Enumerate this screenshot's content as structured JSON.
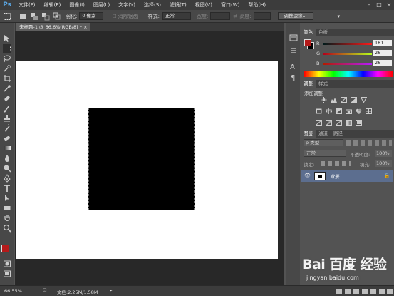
{
  "app": {
    "logo": "Ps"
  },
  "menubar": {
    "items": [
      "文件(F)",
      "编辑(E)",
      "图像(I)",
      "图层(L)",
      "文字(Y)",
      "选择(S)",
      "滤镜(T)",
      "视图(V)",
      "窗口(W)",
      "帮助(H)"
    ]
  },
  "options_bar": {
    "feather_label": "羽化:",
    "feather_value": "0 像素",
    "antialias_label": "消除锯齿",
    "style_label": "样式:",
    "style_value": "正常",
    "width_label": "宽度:",
    "height_label": "高度:",
    "refine_edge_button": "调整边缘..."
  },
  "document": {
    "tab_title": "未标题-1 @ 66.6%(RGB/8) *",
    "close_glyph": "×",
    "zoom": "66.55%",
    "doc_info": "文档:2.25M/1.58M"
  },
  "color_panel": {
    "tabs": [
      "颜色",
      "色板"
    ],
    "foreground_color": "#b51a1a",
    "background_color": "#000000",
    "channels": [
      {
        "label": "R",
        "value": "181"
      },
      {
        "label": "G",
        "value": "26"
      },
      {
        "label": "B",
        "value": "26"
      }
    ]
  },
  "adjustments_panel": {
    "tabs": [
      "调整",
      "样式"
    ],
    "title": "添加调整"
  },
  "layers_panel": {
    "tabs": [
      "图层",
      "通道",
      "路径"
    ],
    "filter_value": "类型",
    "blend_mode": "正常",
    "opacity_label": "不透明度:",
    "opacity_value": "100%",
    "lock_label": "锁定:",
    "fill_label": "填充:",
    "fill_value": "100%",
    "layers": [
      {
        "name": "背景",
        "visible": true,
        "locked": true
      }
    ]
  },
  "watermark": {
    "brand": "Bai 百度 经验",
    "url": "jingyan.baidu.com"
  }
}
